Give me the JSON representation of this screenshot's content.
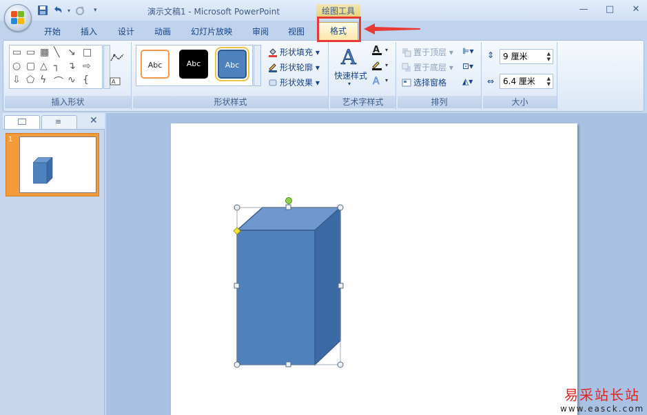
{
  "title_bar": {
    "document_title": "演示文稿1 - Microsoft PowerPoint",
    "contextual_tab_title": "绘图工具",
    "office_button_icon": "office-logo-icon",
    "quick_access": [
      "save-icon",
      "undo-icon",
      "redo-icon",
      "customize-qat-icon"
    ],
    "window_controls": {
      "minimize": "—",
      "maximize": "□",
      "close": "✕"
    }
  },
  "tabs": [
    {
      "label": "开始"
    },
    {
      "label": "插入"
    },
    {
      "label": "设计"
    },
    {
      "label": "动画"
    },
    {
      "label": "幻灯片放映"
    },
    {
      "label": "审阅"
    },
    {
      "label": "视图"
    },
    {
      "label": "格式",
      "active": true
    }
  ],
  "help_label": "?",
  "ribbon": {
    "insert_shapes": {
      "label": "插入形状"
    },
    "shape_styles": {
      "label": "形状样式",
      "swatch_text": "Abc",
      "fill": "形状填充",
      "outline": "形状轮廓",
      "effects": "形状效果"
    },
    "wordart_styles": {
      "label": "艺术字样式",
      "quick_styles": "快速样式"
    },
    "arrange": {
      "label": "排列",
      "bring_front": "置于顶层",
      "send_back": "置于底层",
      "selection_pane": "选择窗格"
    },
    "size": {
      "label": "大小",
      "height": "9 厘米",
      "width": "6.4 厘米"
    }
  },
  "slide_panel": {
    "slide_number": "1"
  },
  "accent_colors": {
    "highlight": "#e83a33",
    "shape_fill": "#4f81bd",
    "thumb_selected": "#f39b3b"
  },
  "watermark": {
    "line1": "易采站长站",
    "line2": "www.easck.com"
  }
}
